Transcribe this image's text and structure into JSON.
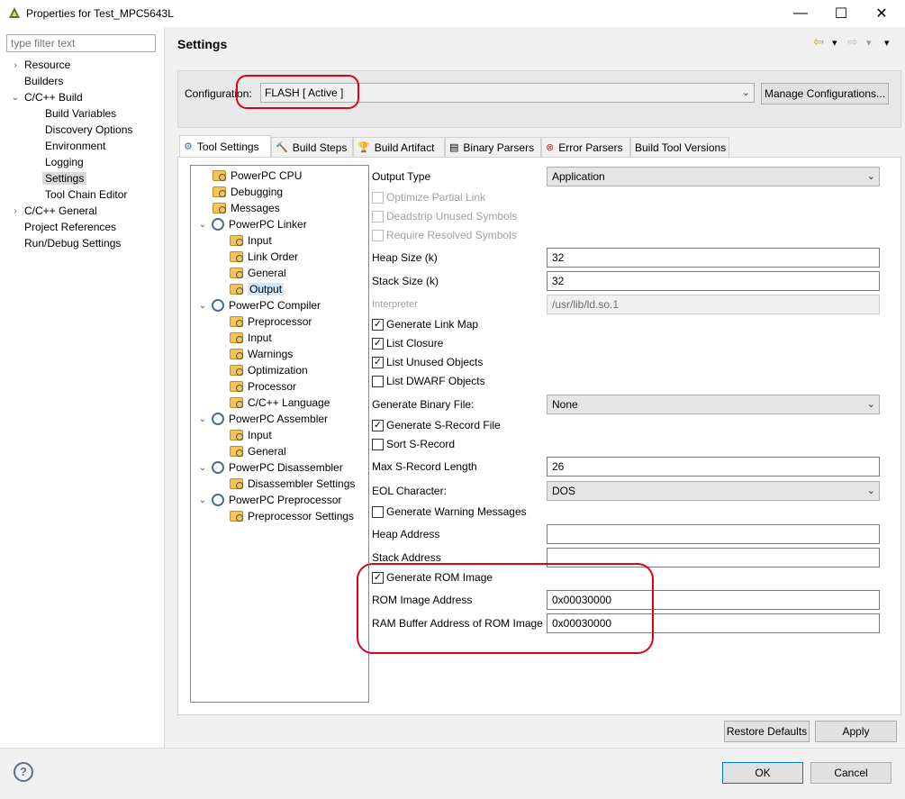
{
  "window": {
    "title": "Properties for Test_MPC5643L",
    "minimize": "—",
    "maximize": "☐",
    "close": "✕"
  },
  "filter": {
    "placeholder": "type filter text"
  },
  "nav": [
    {
      "label": "Resource",
      "chevron": "›"
    },
    {
      "label": "Builders",
      "chevron": ""
    },
    {
      "label": "C/C++ Build",
      "chevron": "⌄"
    },
    {
      "label": "Build Variables",
      "chevron": ""
    },
    {
      "label": "Discovery Options",
      "chevron": ""
    },
    {
      "label": "Environment",
      "chevron": ""
    },
    {
      "label": "Logging",
      "chevron": ""
    },
    {
      "label": "Settings",
      "chevron": "",
      "selected": true
    },
    {
      "label": "Tool Chain Editor",
      "chevron": ""
    },
    {
      "label": "C/C++ General",
      "chevron": "›"
    },
    {
      "label": "Project References",
      "chevron": ""
    },
    {
      "label": "Run/Debug Settings",
      "chevron": ""
    }
  ],
  "settings_title": "Settings",
  "nav_arrows": {
    "back": "⇦",
    "back_menu": "▾",
    "forward": "⇨",
    "forward_menu": "▾",
    "view_menu": "▾"
  },
  "configuration": {
    "label": "Configuration:",
    "value": "FLASH  [ Active ]",
    "manage_label": "Manage Configurations..."
  },
  "tabs": [
    {
      "label": "Tool Settings",
      "icon": "⚙"
    },
    {
      "label": "Build Steps",
      "icon": "🔨"
    },
    {
      "label": "Build Artifact",
      "icon": "🏆"
    },
    {
      "label": "Binary Parsers",
      "icon": "▤"
    },
    {
      "label": "Error Parsers",
      "icon": "⊗"
    },
    {
      "label": "Build Tool Versions",
      "icon": ""
    }
  ],
  "tool_tree": [
    {
      "label": "PowerPC CPU"
    },
    {
      "label": "Debugging"
    },
    {
      "label": "Messages"
    },
    {
      "label": "PowerPC Linker",
      "chevron": "⌄"
    },
    {
      "label": "Input"
    },
    {
      "label": "Link Order"
    },
    {
      "label": "General"
    },
    {
      "label": "Output",
      "selected": true
    },
    {
      "label": "PowerPC Compiler",
      "chevron": "⌄"
    },
    {
      "label": "Preprocessor"
    },
    {
      "label": "Input"
    },
    {
      "label": "Warnings"
    },
    {
      "label": "Optimization"
    },
    {
      "label": "Processor"
    },
    {
      "label": "C/C++ Language"
    },
    {
      "label": "PowerPC Assembler",
      "chevron": "⌄"
    },
    {
      "label": "Input"
    },
    {
      "label": "General"
    },
    {
      "label": "PowerPC Disassembler",
      "chevron": "⌄"
    },
    {
      "label": "Disassembler Settings"
    },
    {
      "label": "PowerPC Preprocessor",
      "chevron": "⌄"
    },
    {
      "label": "Preprocessor Settings"
    }
  ],
  "options": {
    "output_type": {
      "label": "Output Type",
      "value": "Application"
    },
    "optimize_partial_link": {
      "label": "Optimize Partial Link",
      "checked": false,
      "disabled": true
    },
    "deadstrip": {
      "label": "Deadstrip Unused Symbols",
      "checked": false,
      "disabled": true
    },
    "require_resolved": {
      "label": "Require Resolved Symbols",
      "checked": false,
      "disabled": true
    },
    "heap_size": {
      "label": "Heap Size (k)",
      "value": "32"
    },
    "stack_size": {
      "label": "Stack Size (k)",
      "value": "32"
    },
    "interpreter": {
      "label": "Interpreter",
      "value": "/usr/lib/ld.so.1"
    },
    "generate_link_map": {
      "label": "Generate Link Map",
      "checked": true
    },
    "list_closure": {
      "label": "List Closure",
      "checked": true
    },
    "list_unused": {
      "label": "List Unused Objects",
      "checked": true
    },
    "list_dwarf": {
      "label": "List DWARF Objects",
      "checked": false
    },
    "generate_binary": {
      "label": "Generate Binary File:",
      "value": "None"
    },
    "generate_srecord": {
      "label": "Generate S-Record File",
      "checked": true
    },
    "sort_srecord": {
      "label": "Sort S-Record",
      "checked": false
    },
    "max_srecord": {
      "label": "Max S-Record Length",
      "value": "26"
    },
    "eol_character": {
      "label": "EOL Character:",
      "value": "DOS"
    },
    "generate_warnings": {
      "label": "Generate Warning Messages",
      "checked": false
    },
    "heap_address": {
      "label": "Heap Address",
      "value": ""
    },
    "stack_address": {
      "label": "Stack Address",
      "value": ""
    },
    "generate_rom": {
      "label": "Generate ROM Image",
      "checked": true
    },
    "rom_address": {
      "label": "ROM Image Address",
      "value": "0x00030000"
    },
    "ram_buffer": {
      "label": "RAM Buffer Address of ROM Image",
      "value": "0x00030000"
    }
  },
  "checkmark": "✓",
  "combo_arrow": "⌄",
  "buttons": {
    "restore_defaults": "Restore Defaults",
    "apply": "Apply",
    "ok": "OK",
    "cancel": "Cancel",
    "help": "?"
  },
  "colors": {
    "highlight_red": "#e0001b",
    "selection": "#cce8ff",
    "primary_border": "#0078d7"
  }
}
